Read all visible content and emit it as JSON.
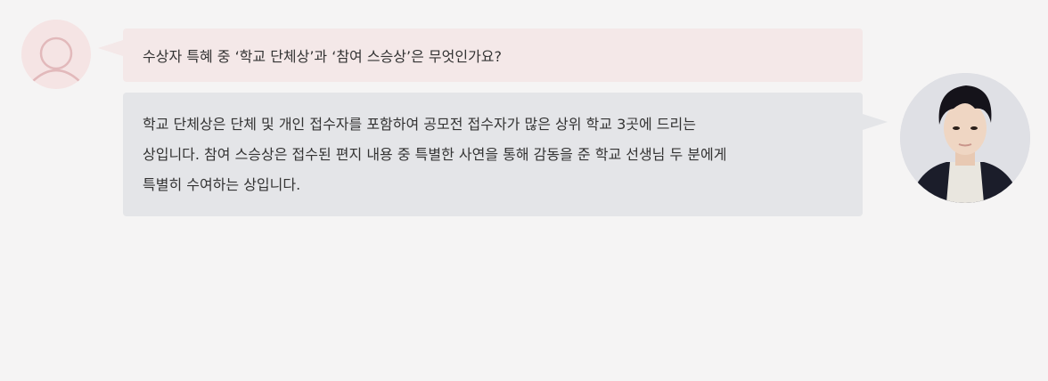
{
  "question": {
    "text": "수상자 특혜 중 ‘학교 단체상’과 ‘참여 스승상’은 무엇인가요?"
  },
  "answer": {
    "lines": [
      "학교 단체상은 단체 및 개인 접수자를 포함하여 공모전 접수자가 많은 상위 학교 3곳에 드리는",
      "상입니다. 참여 스승상은 접수된 편지 내용 중 특별한 사연을 통해 감동을 준 학교 선생님 두 분에게",
      "특별히 수여하는 상입니다."
    ]
  },
  "avatars": {
    "user_icon": "user-outline-icon",
    "guest_icon": "profile-photo"
  },
  "colors": {
    "page_bg": "#f5f4f4",
    "question_bg": "#f4e8e8",
    "answer_bg": "#e4e5e8",
    "user_avatar_bg": "#f5e4e4",
    "user_avatar_stroke": "#e2b9bb",
    "text": "#333333"
  }
}
